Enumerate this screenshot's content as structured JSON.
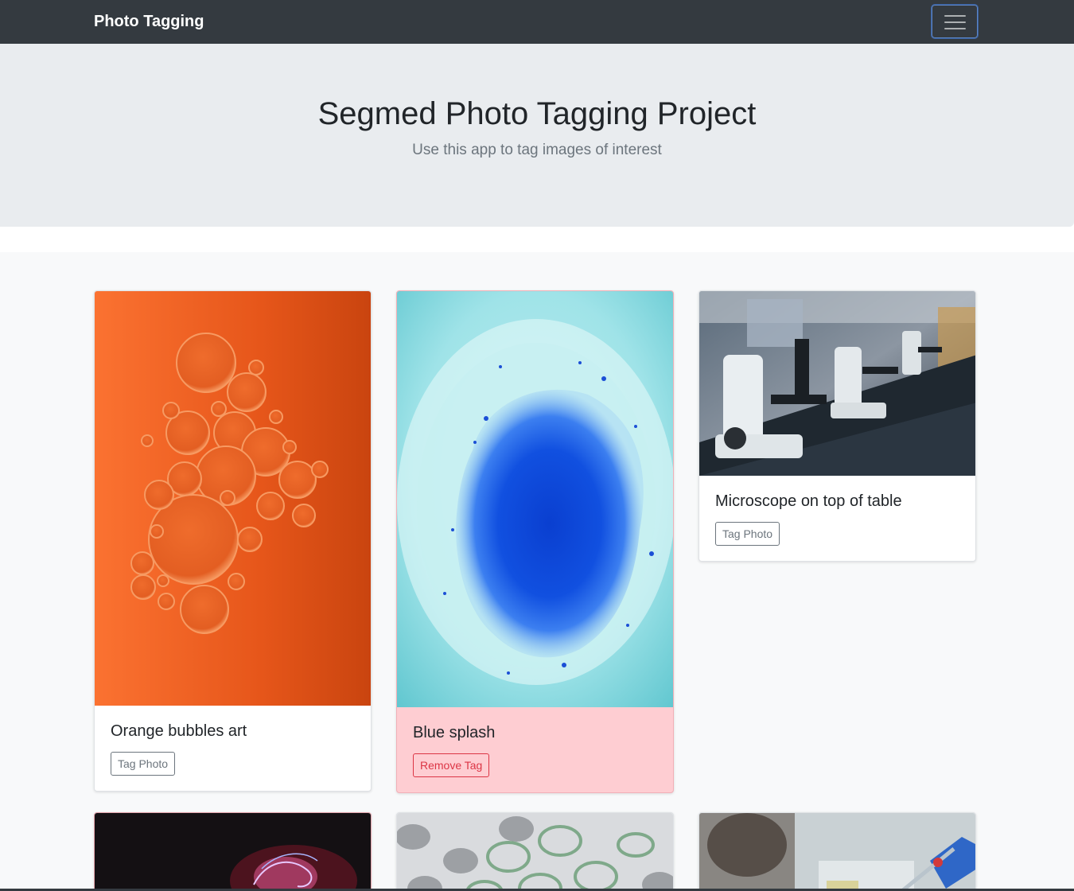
{
  "navbar": {
    "brand": "Photo Tagging",
    "toggle_icon": "hamburger-icon"
  },
  "jumbotron": {
    "title": "Segmed Photo Tagging Project",
    "lead": "Use this app to tag images of interest"
  },
  "cards": [
    {
      "title": "Orange bubbles art",
      "button_label": "Tag Photo",
      "tagged": false,
      "image": "orange-bubbles-image"
    },
    {
      "title": "Blue splash",
      "button_label": "Remove Tag",
      "tagged": true,
      "image": "blue-splash-image"
    },
    {
      "title": "Microscope on top of table",
      "button_label": "Tag Photo",
      "tagged": false,
      "image": "microscope-image"
    },
    {
      "image": "plasma-image"
    },
    {
      "image": "test-tubes-image"
    },
    {
      "image": "lab-pipette-image"
    }
  ],
  "colors": {
    "navbar": "#343a40",
    "jumbotron": "#e9ecef",
    "album_bg": "#f8f9fa",
    "tagged_card": "#fecdd2",
    "danger": "#dc3545",
    "secondary": "#6c757d"
  }
}
